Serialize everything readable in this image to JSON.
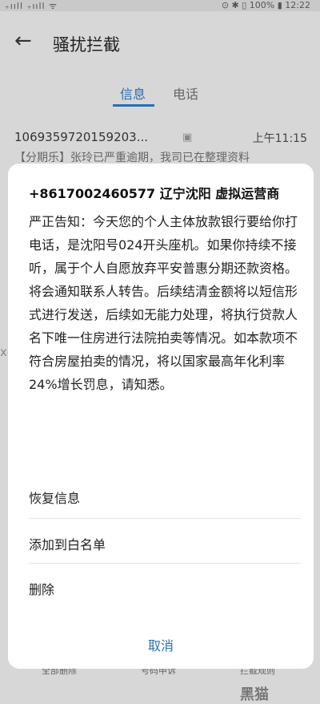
{
  "status_bar": {
    "left": "₊ııll ₊ııll ᯤ",
    "right": "⊙ ✱ ▯ 100% ▮ 12:22"
  },
  "header": {
    "title": "骚扰拦截"
  },
  "tabs": [
    {
      "label": "信息"
    },
    {
      "label": "电话"
    }
  ],
  "message_preview": {
    "sender": "1069359720159203...",
    "time": "上午11:15",
    "snippet": "【分期乐】张玲已严重逾期，我司已在整理资料"
  },
  "side_watermark": "xds",
  "dialog": {
    "title": "+8617002460577 辽宁沈阳 虚拟运营商",
    "body": "严正告知：今天您的个人主体放款银行要给你打电话，是沈阳号024开头座机。如果你持续不接听，属于个人自愿放弃平安普惠分期还款资格。将会通知联系人转告。后续结清金额将以短信形式进行发送，后续如无能力处理，将执行贷款人名下唯一住房进行法院拍卖等情况。如本款项不符合房屋拍卖的情况，将以国家最高年化利率24%增长罚息，请知悉。",
    "options": [
      "恢复信息",
      "添加到白名单",
      "删除"
    ],
    "cancel": "取消"
  },
  "footer": {
    "items": [
      "全部删除",
      "号码申诉",
      "拦截规则"
    ]
  },
  "watermark": "黑猫"
}
